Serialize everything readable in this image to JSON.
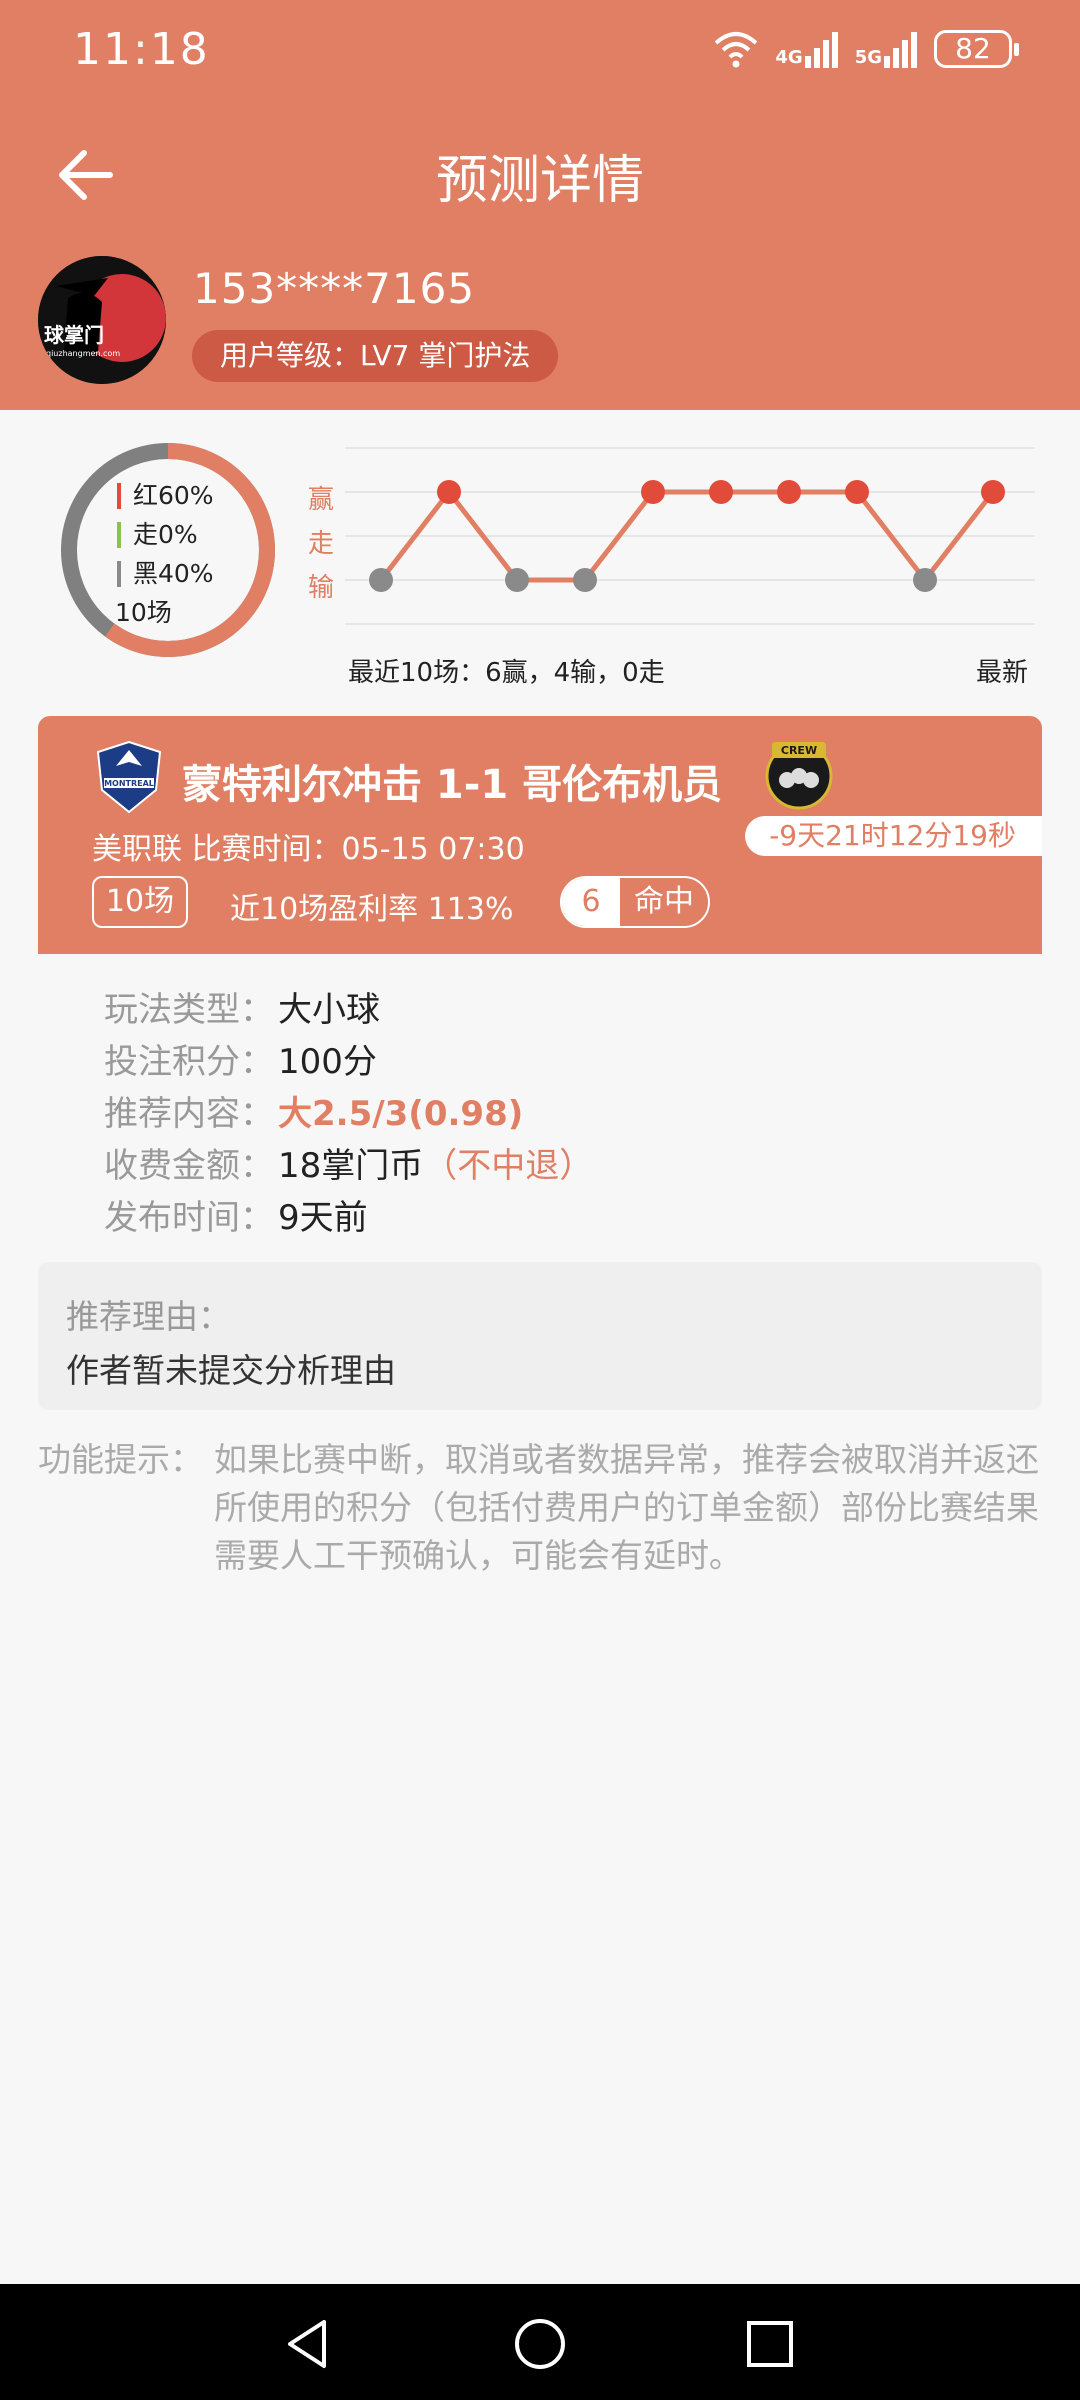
{
  "status_bar": {
    "time": "11:18",
    "signal1": "4G",
    "signal2": "5G",
    "battery": "82"
  },
  "header": {
    "title": "预测详情"
  },
  "user": {
    "phone": "153****7165",
    "level": "用户等级：LV7 掌门护法",
    "avatar_text": "球掌门",
    "avatar_url": "qiuzhangmen.com"
  },
  "stats": {
    "win": "红60%",
    "draw": "走0%",
    "lose": "黑40%",
    "total": "10场",
    "trend_labels": [
      "赢",
      "走",
      "输"
    ],
    "recent_summary": "最近10场：6赢，4输，0走",
    "newest_label": "最新",
    "win_pct": 0.6,
    "lose_pct": 0.4,
    "draw_pct": 0.0,
    "results": [
      "输",
      "赢",
      "输",
      "输",
      "赢",
      "赢",
      "赢",
      "赢",
      "输",
      "赢"
    ],
    "colors": {
      "win": "#e04b3a",
      "draw": "#8bc34a",
      "lose": "#8a8a8a"
    }
  },
  "match": {
    "title": "蒙特利尔冲击 1-1 哥伦布机员",
    "league_time": "美职联 比赛时间：05-15 07:30",
    "countdown": "-9天21时12分19秒",
    "games": "10场",
    "profit": "近10场盈利率 113%",
    "hit_num": "6",
    "hit_label": "命中",
    "home_logo_text": "MONTREAL",
    "away_logo_text": "CREW"
  },
  "details": {
    "play_type_key": "玩法类型：",
    "play_type": "大小球",
    "points_key": "投注积分：",
    "points": "100分",
    "content_key": "推荐内容：",
    "content": "大2.5/3(0.98)",
    "fee_key": "收费金额：",
    "fee": "18掌门币",
    "fee_note": "（不中退）",
    "publish_key": "发布时间：",
    "publish": "9天前"
  },
  "reason": {
    "key": "推荐理由：",
    "value": "作者暂未提交分析理由"
  },
  "tip": {
    "key": "功能提示：",
    "value": "如果比赛中断，取消或者数据异常，推荐会被取消并返还所使用的积分（包括付费用户的订单金额）部份比赛结果需要人工干预确认，可能会有延时。"
  },
  "colors": {
    "accent": "#e07f63",
    "dark_accent": "#cc5a45"
  }
}
